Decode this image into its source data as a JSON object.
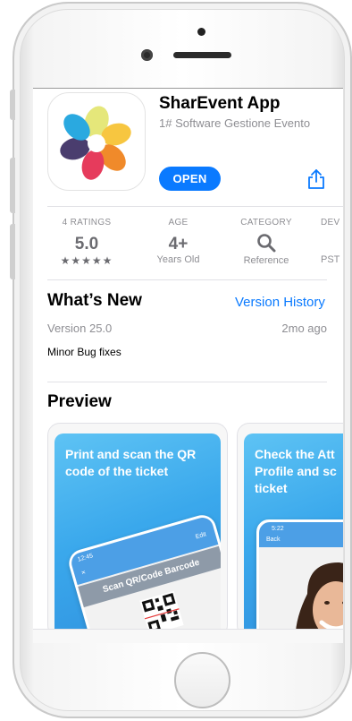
{
  "app": {
    "name": "SharEvent App",
    "subtitle": "1# Software Gestione Evento",
    "open_label": "OPEN"
  },
  "info": {
    "ratings": {
      "label": "4 RATINGS",
      "value": "5.0",
      "stars": "★★★★★"
    },
    "age": {
      "label": "AGE",
      "value": "4+",
      "sub": "Years Old"
    },
    "category": {
      "label": "CATEGORY",
      "sub": "Reference"
    },
    "developer": {
      "label": "DEV",
      "sub": "PST"
    }
  },
  "whats_new": {
    "title": "What’s New",
    "link": "Version History",
    "version": "Version 25.0",
    "ago": "2mo ago",
    "notes": "Minor Bug fixes"
  },
  "preview": {
    "title": "Preview",
    "cards": [
      {
        "caption": "Print and scan the QR code of the ticket",
        "time": "12:45",
        "edit": "Edit",
        "close": "×",
        "scan_label": "Scan QR/Code Barcode"
      },
      {
        "caption": "Check the Att Profile and sc ticket",
        "time": "5:22",
        "back": "Back"
      }
    ]
  },
  "colors": {
    "accent": "#0a7aff",
    "preview_bg": "#3aa8ec"
  },
  "icons": [
    "share-icon",
    "magnifier-icon",
    "star-icon",
    "home-button"
  ]
}
